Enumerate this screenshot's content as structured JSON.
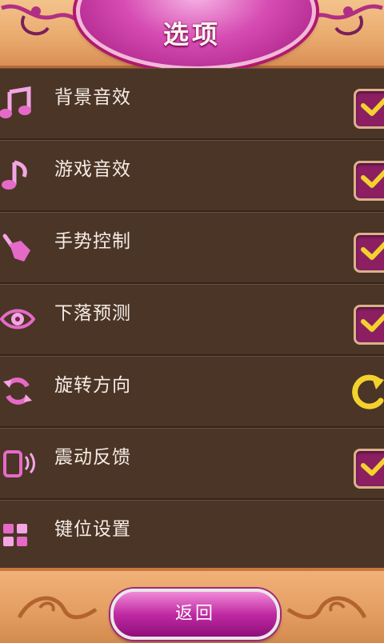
{
  "header": {
    "title": "选项"
  },
  "options": [
    {
      "label": "背景音效",
      "icon": "double-music-note-icon",
      "control": "checkbox",
      "checked": true
    },
    {
      "label": "游戏音效",
      "icon": "music-note-icon",
      "control": "checkbox",
      "checked": true
    },
    {
      "label": "手势控制",
      "icon": "hand-gesture-icon",
      "control": "checkbox",
      "checked": true
    },
    {
      "label": "下落预测",
      "icon": "eye-icon",
      "control": "checkbox",
      "checked": true
    },
    {
      "label": "旋转方向",
      "icon": "rotate-arrows-icon",
      "control": "rotate-toggle"
    },
    {
      "label": "震动反馈",
      "icon": "phone-vibrate-icon",
      "control": "checkbox",
      "checked": true
    },
    {
      "label": "键位设置",
      "icon": "grid-keys-icon",
      "control": "none"
    }
  ],
  "footer": {
    "back_label": "返回"
  },
  "colors": {
    "accent_pink": "#d64cb2",
    "row_bg": "#4b3526",
    "check_yellow": "#f4d22e",
    "frame_orange": "#e9a96c"
  }
}
